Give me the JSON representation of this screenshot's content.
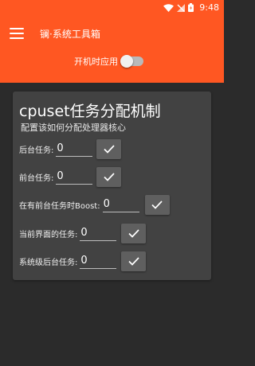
{
  "status_bar": {
    "time": "9:48"
  },
  "app_bar": {
    "title": "镧·系统工具箱"
  },
  "boot": {
    "label": "开机时应用"
  },
  "card": {
    "title": "cpuset任务分配机制",
    "subtitle": "配置该如何分配处理器核心",
    "rows": [
      {
        "label": "后台任务:",
        "value": "0"
      },
      {
        "label": "前台任务:",
        "value": "0"
      },
      {
        "label": "在有前台任务时Boost:",
        "value": "0"
      },
      {
        "label": "当前界面的任务:",
        "value": "0"
      },
      {
        "label": "系统级后台任务:",
        "value": "0"
      }
    ]
  },
  "colors": {
    "accent": "#ff5722",
    "background": "#2b2b2b",
    "card": "#424242",
    "button": "#5f5f5f"
  }
}
